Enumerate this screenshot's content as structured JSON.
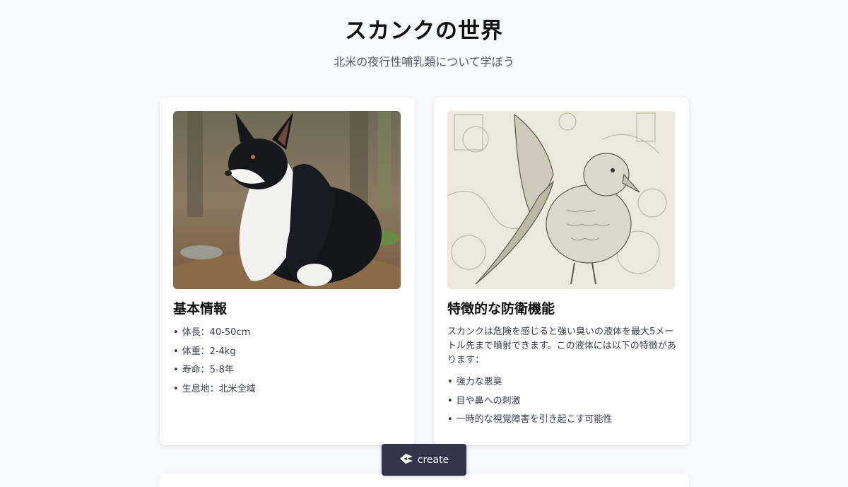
{
  "header": {
    "title": "スカンクの世界",
    "subtitle": "北米の夜行性哺乳類について学ぼう"
  },
  "cards": [
    {
      "title": "基本情報",
      "image_icon": "skunk-like-animal-photo",
      "items": [
        "体長：40-50cm",
        "体重：2-4kg",
        "寿命：5-8年",
        "生息地：北米全域"
      ]
    },
    {
      "title": "特徴的な防衛機能",
      "image_icon": "bird-illustration",
      "description": "スカンクは危険を感じると強い臭いの液体を最大5メートル先まで噴射できます。この液体には以下の特徴があります：",
      "items": [
        "強力な悪臭",
        "目や鼻への刺激",
        "一時的な視覚障害を引き起こす可能性"
      ]
    }
  ],
  "create_button": {
    "label": "create",
    "icon": "create-logo-icon"
  },
  "colors": {
    "background": "#f8f9fb",
    "card": "#ffffff",
    "button": "#34344a"
  }
}
